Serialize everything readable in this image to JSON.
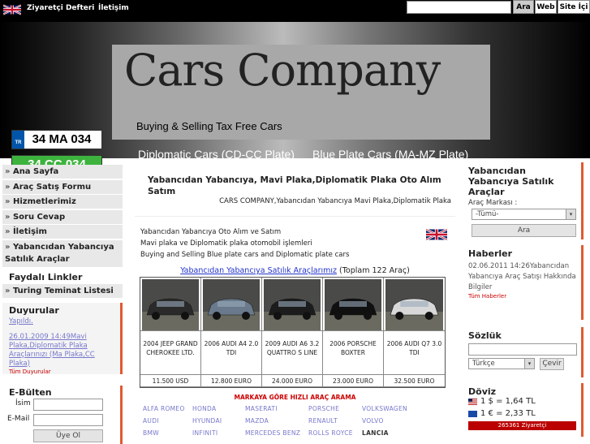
{
  "topbar": {
    "links": [
      "Ziyaretçi Defteri",
      "İletişim"
    ],
    "search_placeholder": "",
    "buttons": [
      "Ara",
      "Web",
      "Site İçi"
    ]
  },
  "header": {
    "logo": "Cars Company",
    "tagline": "Buying & Selling Tax Free Cars",
    "plate1": "34 MA 034",
    "plate1_country": "TR",
    "plate2": "34 CC 034",
    "link1": "Diplomatic Cars (CD-CC Plate)",
    "link2": "Blue Plate Cars (MA-MZ Plate)"
  },
  "nav": {
    "items": [
      "Ana Sayfa",
      "Araç Satış Formu",
      "Hizmetlerimiz",
      "Soru Cevap",
      "İletişim",
      "Yabancıdan Yabancıya Satılık Araçlar"
    ],
    "useful_title": "Faydalı Linkler",
    "useful_items": [
      "Turing Teminat Listesi"
    ]
  },
  "announcements": {
    "title": "Duyurular",
    "sub": "Yapıldı.",
    "item": "26.01.2009 14:49Mavi Plaka,Diplomatik Plaka Araçlarınızı (Ma Plaka,CC Plaka)",
    "all_link": "Tüm Duyurular"
  },
  "newsletter": {
    "title": "E-Bülten",
    "name_label": "İsim",
    "email_label": "E-Mail",
    "submit": "Üye Ol"
  },
  "main": {
    "title": "Yabancıdan Yabancıya, Mavi Plaka,Diplomatik Plaka Oto Alım Satım",
    "subtitle": "CARS COMPANY,Yabancıdan Yabancıya Mavi Plaka,Diplomatik Plaka",
    "desc": [
      "Yabancıdan Yabancıya Oto Alım ve Satım",
      "Mavi plaka ve Diplomatik plaka otomobil işlemleri",
      "Buying and Selling Blue plate cars and Diplomatic plate cars"
    ],
    "cars_link": "Yabancıdan Yabancıya Satılık Araçlarımız",
    "cars_count": "(Toplam 122 Araç)",
    "cars": [
      {
        "name": "2004 JEEP GRAND CHEROKEE LTD.",
        "price": "11.500 USD",
        "color": "#2a2a2a"
      },
      {
        "name": "2006 AUDI A4 2.0 TDI",
        "price": "12.800 EURO",
        "color": "#6a7a8c"
      },
      {
        "name": "2009 AUDI A6 3.2 QUATTRO S LINE",
        "price": "24.000 EURO",
        "color": "#1c1c1c"
      },
      {
        "name": "2006 PORSCHE BOXTER",
        "price": "23.000 EURO",
        "color": "#101010"
      },
      {
        "name": "2006 AUDI Q7 3.0 TDI",
        "price": "32.500 EURO",
        "color": "#d8d8d8"
      }
    ],
    "brand_title": "MARKAYA GÖRE HIZLI ARAÇ ARAMA",
    "brands": [
      "ALFA ROMEO",
      "HONDA",
      "MASERATI",
      "PORSCHE",
      "VOLKSWAGEN",
      "AUDI",
      "HYUNDAI",
      "MAZDA",
      "RENAULT",
      "VOLVO",
      "BMW",
      "INFINITI",
      "MERCEDES BENZ",
      "ROLLS ROYCE",
      "LANCIA"
    ]
  },
  "right": {
    "search_title": "Yabancıdan Yabancıya Satılık Araçlar",
    "brand_label": "Araç Markası :",
    "brand_select": "-Tümü-",
    "search_button": "Ara",
    "news_title": "Haberler",
    "news_item": "02.06.2011 14:26Yabancıdan Yabancıya Araç Satışı Hakkında Bilgiler",
    "news_all": "Tüm Haberler",
    "dict_title": "Sözlük",
    "dict_lang": "Türkçe",
    "dict_button": "Çevir",
    "currency_title": "Döviz",
    "usd": "1 $ = 1,64 TL",
    "eur": "1 € = 2,33 TL",
    "visits": "265361 Ziyaretçi"
  }
}
